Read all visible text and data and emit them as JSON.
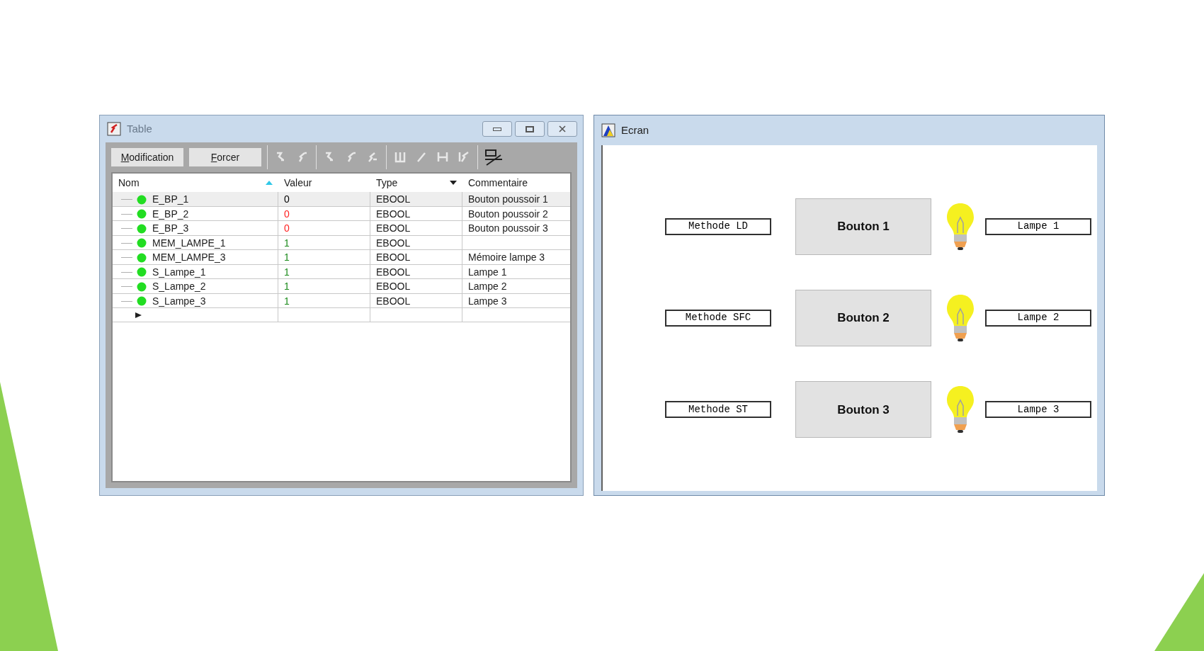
{
  "table_window": {
    "title": "Table",
    "buttons": [
      "Modification",
      "Forcer"
    ],
    "columns": [
      {
        "label": "Nom",
        "kind": "sort"
      },
      {
        "label": "Valeur",
        "kind": "plain"
      },
      {
        "label": "Type",
        "kind": "dropdown"
      },
      {
        "label": "Commentaire",
        "kind": "plain"
      }
    ],
    "rows": [
      {
        "name": "E_BP_1",
        "value": "0",
        "color": "#000000",
        "type": "EBOOL",
        "comment": "Bouton poussoir 1",
        "selected": true
      },
      {
        "name": "E_BP_2",
        "value": "0",
        "color": "#ff2020",
        "type": "EBOOL",
        "comment": "Bouton poussoir 2",
        "selected": false
      },
      {
        "name": "E_BP_3",
        "value": "0",
        "color": "#ff2020",
        "type": "EBOOL",
        "comment": "Bouton poussoir 3",
        "selected": false
      },
      {
        "name": "MEM_LAMPE_1",
        "value": "1",
        "color": "#1a8a1a",
        "type": "EBOOL",
        "comment": "",
        "selected": false
      },
      {
        "name": "MEM_LAMPE_3",
        "value": "1",
        "color": "#1a8a1a",
        "type": "EBOOL",
        "comment": "Mémoire lampe 3",
        "selected": false
      },
      {
        "name": "S_Lampe_1",
        "value": "1",
        "color": "#1a8a1a",
        "type": "EBOOL",
        "comment": "Lampe 1",
        "selected": false
      },
      {
        "name": "S_Lampe_2",
        "value": "1",
        "color": "#1a8a1a",
        "type": "EBOOL",
        "comment": "Lampe 2",
        "selected": false
      },
      {
        "name": "S_Lampe_3",
        "value": "1",
        "color": "#1a8a1a",
        "type": "EBOOL",
        "comment": "Lampe 3",
        "selected": false
      }
    ]
  },
  "screen_window": {
    "title": "Ecran",
    "rows": [
      {
        "method": "Methode LD",
        "button": "Bouton 1",
        "lamp": "Lampe 1",
        "lit": true
      },
      {
        "method": "Methode SFC",
        "button": "Bouton 2",
        "lamp": "Lampe 2",
        "lit": true
      },
      {
        "method": "Methode ST",
        "button": "Bouton 3",
        "lamp": "Lampe 3",
        "lit": true
      }
    ]
  }
}
